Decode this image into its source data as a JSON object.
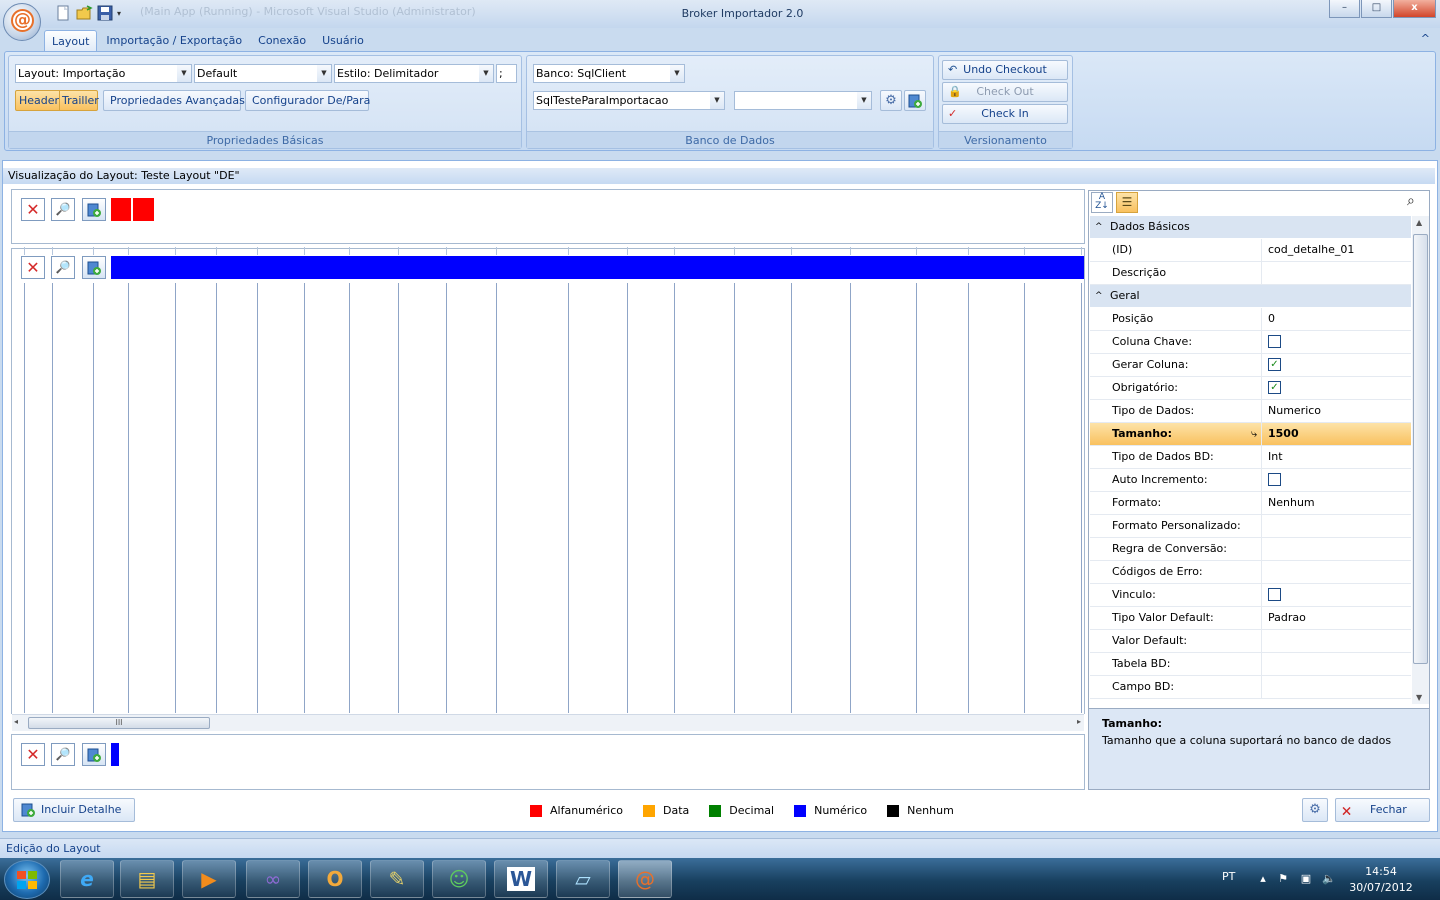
{
  "window": {
    "title": "Broker Importador 2.0",
    "ghost_title": "(Main App (Running) - Microsoft Visual Studio (Administrator)",
    "controls": {
      "minimize": "–",
      "maximize": "□",
      "close": "x"
    }
  },
  "ribbon": {
    "tabs": [
      {
        "label": "Layout",
        "active": true
      },
      {
        "label": "Importação / Exportação"
      },
      {
        "label": "Conexão"
      },
      {
        "label": "Usuário"
      }
    ],
    "collapse_icon": "chevron-up-icon",
    "groups": {
      "basicas": {
        "label": "Propriedades Básicas",
        "layout_combo": "Layout: Importação",
        "default_combo": "Default",
        "estilo_combo": "Estilo: Delimitador",
        "delimiter_value": ";",
        "header_button": "Header",
        "trailler_button": "Trailler",
        "avancadas_button": "Propriedades Avançadas",
        "depara_button": "Configurador De/Para"
      },
      "banco": {
        "label": "Banco de Dados",
        "banco_combo": "Banco: SqlClient",
        "conexao_combo": "SqlTesteParaImportacao",
        "empty_combo": ""
      },
      "versionamento": {
        "label": "Versionamento",
        "undo_checkout": "Undo Checkout",
        "check_out": "Check Out",
        "check_in": "Check In"
      }
    }
  },
  "content": {
    "title": "Visualização do Layout: Teste Layout \"DE\"",
    "header_panel": {
      "field_colors": [
        "#ff0000",
        "#ff0000"
      ]
    },
    "detail_panel": {
      "field_color": "#0000ff"
    },
    "trailer_panel": {
      "field_color": "#0000ff"
    },
    "scroll_grip": "III"
  },
  "properties": {
    "search_placeholder": "",
    "categories": [
      {
        "name": "Dados Básicos",
        "rows": [
          {
            "name": "(ID)",
            "value": "cod_detalhe_01"
          },
          {
            "name": "Descrição",
            "value": ""
          }
        ]
      },
      {
        "name": "Geral",
        "rows": [
          {
            "name": "Posição",
            "value": "0"
          },
          {
            "name": "Coluna Chave:",
            "checkbox": false
          },
          {
            "name": "Gerar Coluna:",
            "checkbox": true
          },
          {
            "name": "Obrigatório:",
            "checkbox": true
          },
          {
            "name": "Tipo de Dados:",
            "value": "Numerico"
          },
          {
            "name": "Tamanho:",
            "value": "1500",
            "selected": true
          },
          {
            "name": "Tipo de Dados BD:",
            "value": "Int"
          },
          {
            "name": "Auto Incremento:",
            "checkbox": false
          },
          {
            "name": "Formato:",
            "value": "Nenhum"
          },
          {
            "name": "Formato Personalizado:",
            "value": ""
          },
          {
            "name": "Regra de Conversão:",
            "value": ""
          },
          {
            "name": "Códigos de Erro:",
            "value": ""
          },
          {
            "name": "Vinculo:",
            "checkbox": false
          },
          {
            "name": "Tipo Valor Default:",
            "value": "Padrao"
          },
          {
            "name": "Valor Default:",
            "value": ""
          },
          {
            "name": "Tabela BD:",
            "value": ""
          },
          {
            "name": "Campo BD:",
            "value": ""
          }
        ]
      }
    ],
    "description": {
      "title": "Tamanho:",
      "text": "Tamanho que a coluna suportará no banco de dados"
    }
  },
  "legend": [
    {
      "label": "Alfanumérico",
      "color": "#ff0000"
    },
    {
      "label": "Data",
      "color": "#ffa500"
    },
    {
      "label": "Decimal",
      "color": "#008000"
    },
    {
      "label": "Numérico",
      "color": "#0000ff"
    },
    {
      "label": "Nenhum",
      "color": "#000000"
    }
  ],
  "buttons": {
    "incluir_detalhe": "Incluir Detalhe",
    "fechar": "Fechar"
  },
  "status_bar": "Edição do Layout",
  "taskbar": {
    "apps": [
      "start-orb",
      "internet-explorer",
      "file-explorer",
      "media-player",
      "visual-studio",
      "outlook",
      "project-tool",
      "messenger",
      "word",
      "notepad",
      "broker-importador"
    ],
    "language": "PT",
    "time": "14:54",
    "date": "30/07/2012"
  }
}
